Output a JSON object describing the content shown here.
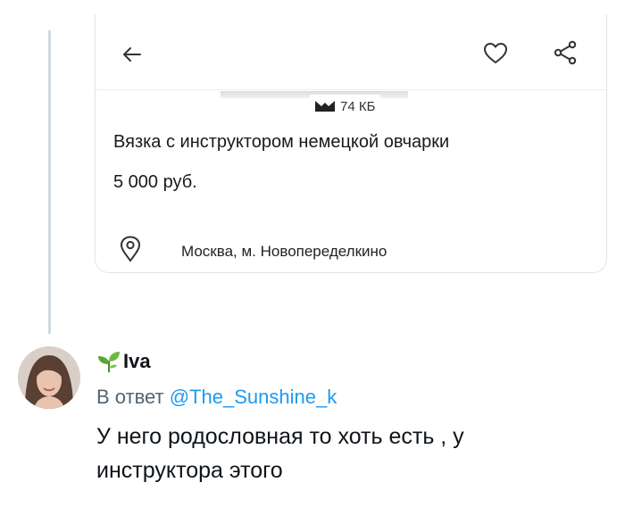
{
  "ad_card": {
    "size_label": "74 КБ",
    "title": "Вязка с инструктором немецкой овчарки",
    "price": "5 000 руб.",
    "location": "Москва, м. Новопеределкино"
  },
  "reply": {
    "username": "Iva",
    "reply_prefix": "В ответ",
    "mention": "@The_Sunshine_k",
    "text": "У него родословная то хоть есть , у инструктора этого"
  },
  "colors": {
    "mention": "#1d9bf0",
    "secondary_text": "#536471",
    "thread_line": "#cfd9de"
  },
  "icons": [
    "back-arrow-icon",
    "heart-icon",
    "share-icon",
    "location-pin-icon",
    "sprout-icon"
  ]
}
